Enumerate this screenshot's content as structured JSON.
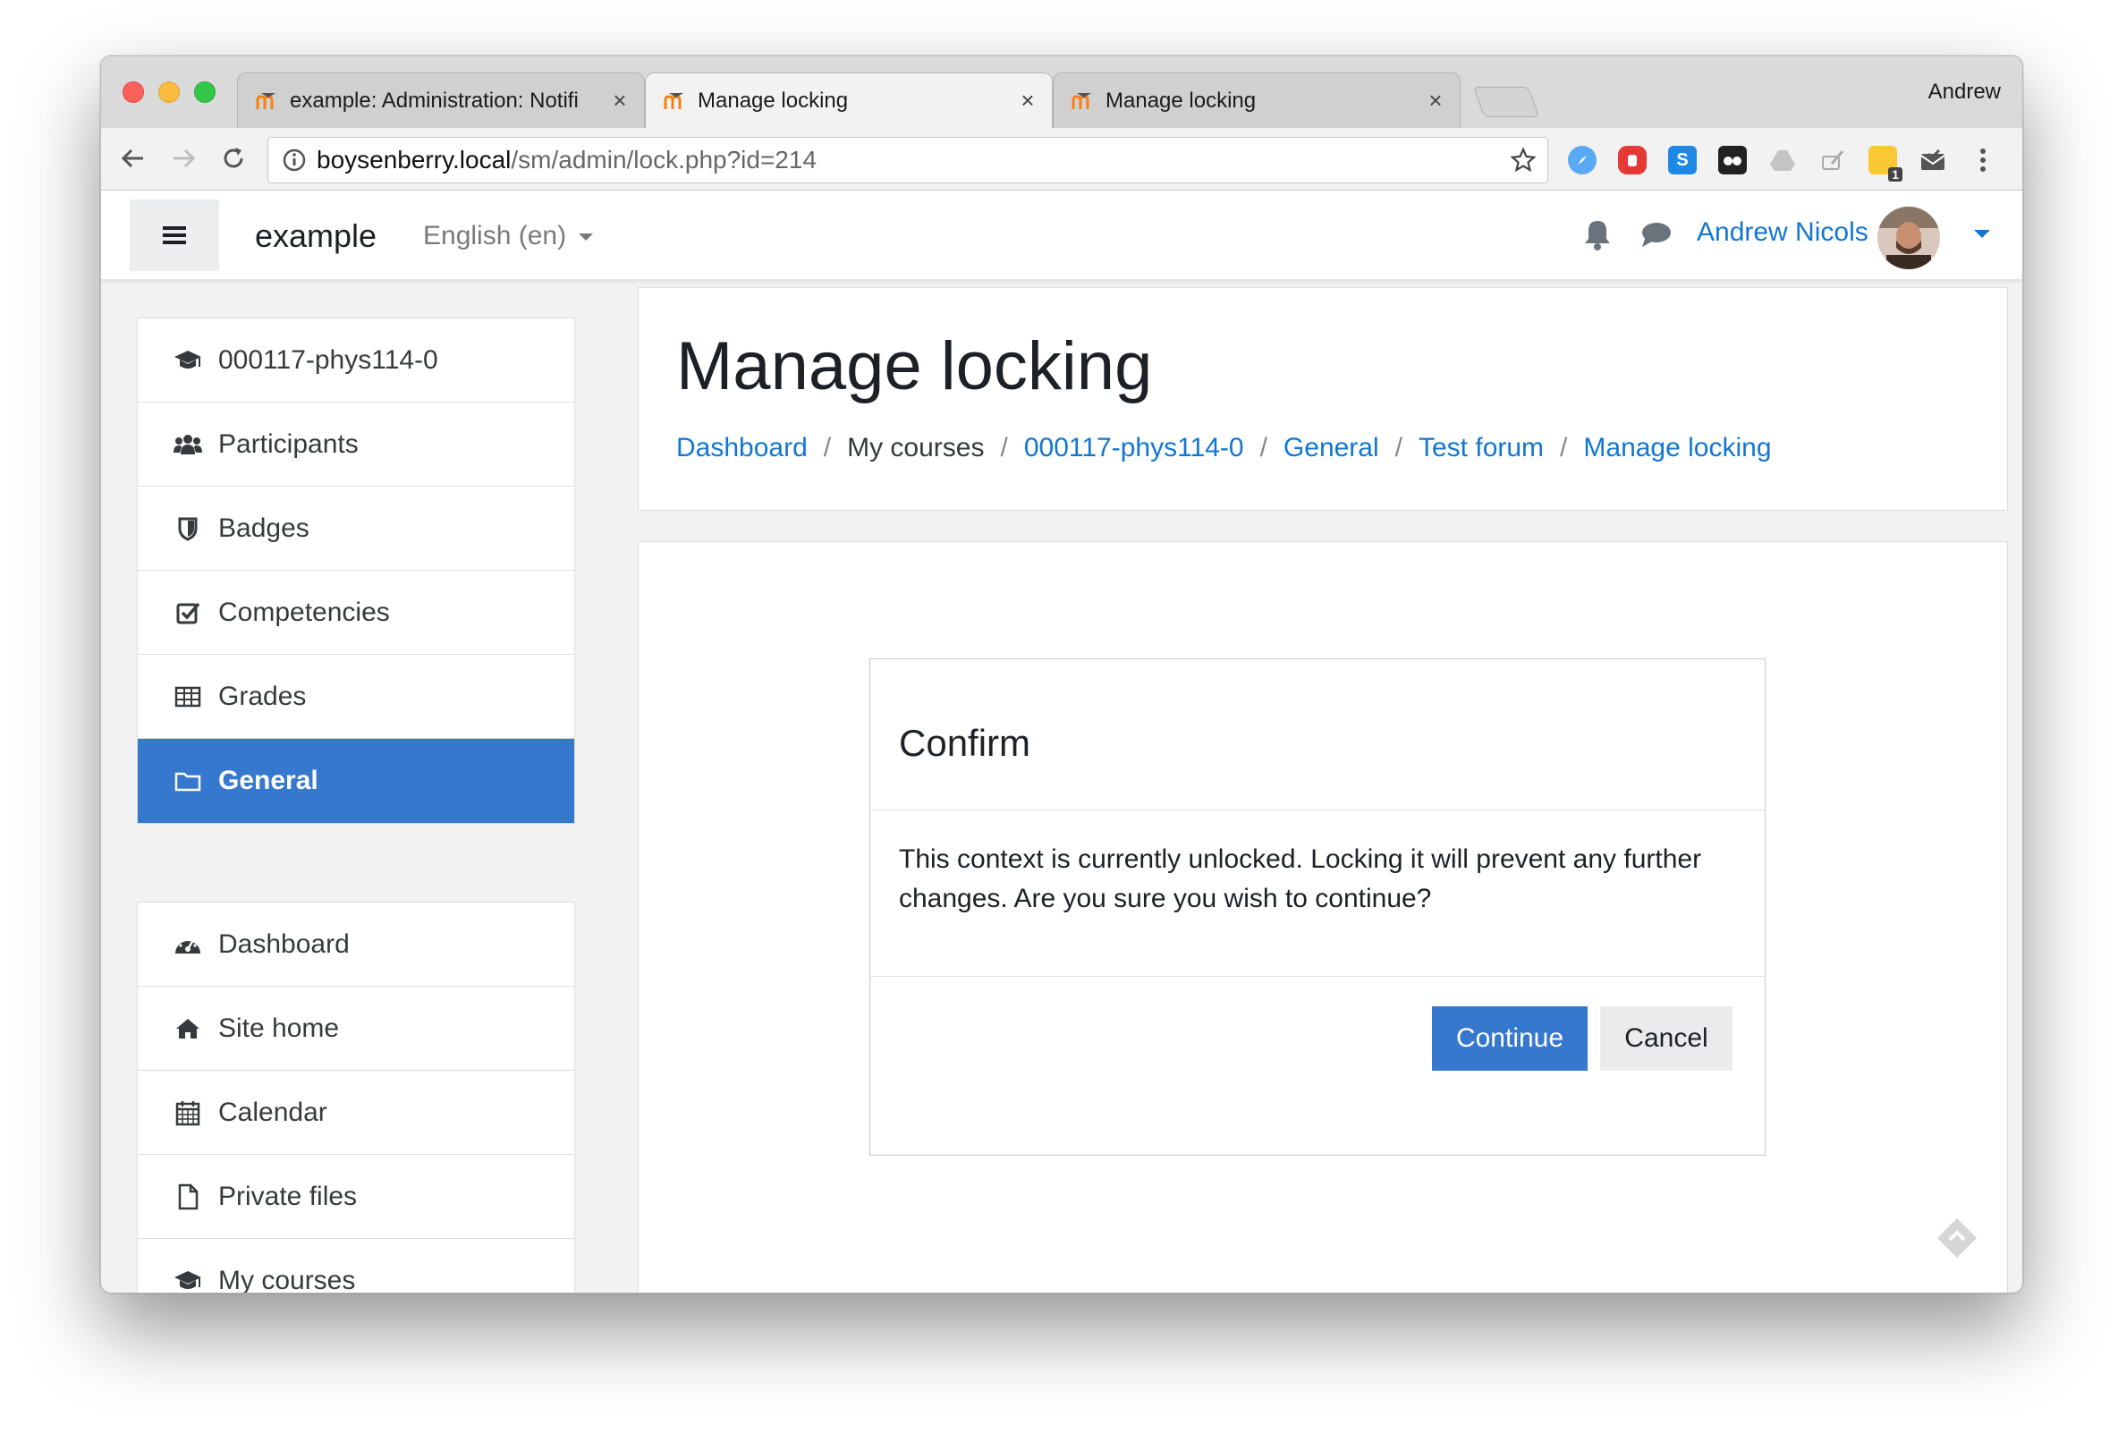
{
  "browser": {
    "tabs": [
      {
        "title": "example: Administration: Notifi",
        "active": false
      },
      {
        "title": "Manage locking",
        "active": true
      },
      {
        "title": "Manage locking",
        "active": false
      }
    ],
    "profile_name": "Andrew",
    "url_host": "boysenberry.local",
    "url_path": "/sm/admin/lock.php?id=214",
    "icons": [
      "back-icon",
      "forward-icon",
      "reload-icon",
      "info-icon",
      "star-icon",
      "menu-dots-icon"
    ],
    "extensions": [
      "safari-compass-extension-icon",
      "adblock-extension-icon",
      "skype-extension-icon",
      "ghostery-extension-icon",
      "drive-extension-icon",
      "brush-extension-icon",
      "feedly-extension-icon",
      "mail-extension-icon"
    ],
    "extension_badge": "1"
  },
  "navbar": {
    "site_name": "example",
    "language": "English (en)",
    "user_name": "Andrew Nicols"
  },
  "sidebar": {
    "course_items": [
      {
        "label": "000117-phys114-0",
        "icon": "graduation-cap-icon"
      },
      {
        "label": "Participants",
        "icon": "users-icon"
      },
      {
        "label": "Badges",
        "icon": "shield-icon"
      },
      {
        "label": "Competencies",
        "icon": "checkbox-icon"
      },
      {
        "label": "Grades",
        "icon": "table-icon"
      },
      {
        "label": "General",
        "icon": "folder-icon",
        "active": true
      }
    ],
    "site_items": [
      {
        "label": "Dashboard",
        "icon": "dashboard-icon"
      },
      {
        "label": "Site home",
        "icon": "home-icon"
      },
      {
        "label": "Calendar",
        "icon": "calendar-icon"
      },
      {
        "label": "Private files",
        "icon": "file-icon"
      },
      {
        "label": "My courses",
        "icon": "graduation-cap-icon"
      }
    ]
  },
  "page": {
    "title": "Manage locking",
    "breadcrumb": [
      {
        "label": "Dashboard",
        "link": true
      },
      {
        "label": "My courses",
        "link": false
      },
      {
        "label": "000117-phys114-0",
        "link": true
      },
      {
        "label": "General",
        "link": true
      },
      {
        "label": "Test forum",
        "link": true
      },
      {
        "label": "Manage locking",
        "link": true
      }
    ],
    "separator": "/"
  },
  "dialog": {
    "title": "Confirm",
    "message": "This context is currently unlocked. Locking it will prevent any further changes. Are you sure you wish to continue?",
    "continue_label": "Continue",
    "cancel_label": "Cancel"
  },
  "colors": {
    "brand": "#3778cf",
    "link": "#1177d1",
    "active_nav": "#3778cf"
  }
}
